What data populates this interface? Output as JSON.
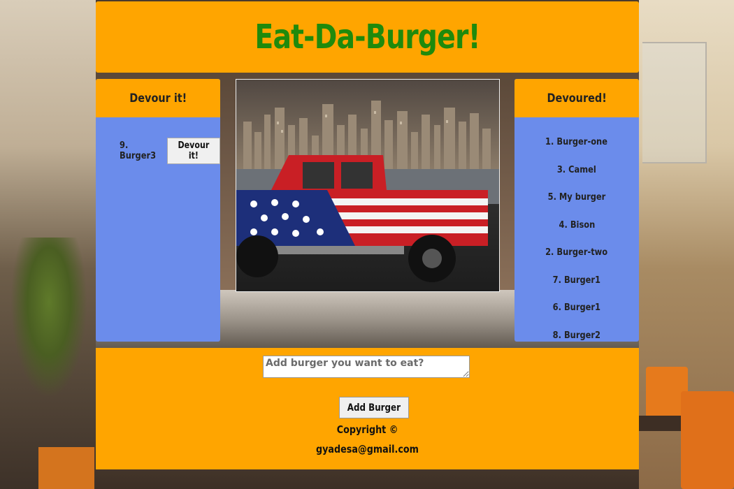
{
  "header": {
    "title": "Eat-Da-Burger!"
  },
  "left_panel": {
    "title": "Devour it!",
    "items": [
      {
        "label": "9. Burger3",
        "button_label": "Devour it!"
      }
    ]
  },
  "right_panel": {
    "title": "Devoured!",
    "items": [
      "1. Burger-one",
      "3. Camel",
      "5. My burger",
      "4. Bison",
      "2. Burger-two",
      "7. Burger1",
      "6. Burger1",
      "8. Burger2"
    ]
  },
  "form": {
    "placeholder": "Add burger you want to eat?",
    "value": "",
    "submit_label": "Add Burger"
  },
  "footer": {
    "copyright": "Copyright ©",
    "email": "gyadesa@gmail.com"
  },
  "colors": {
    "accent": "#FFA500",
    "panel": "#6B8CEB",
    "title": "#1F8A0C"
  }
}
